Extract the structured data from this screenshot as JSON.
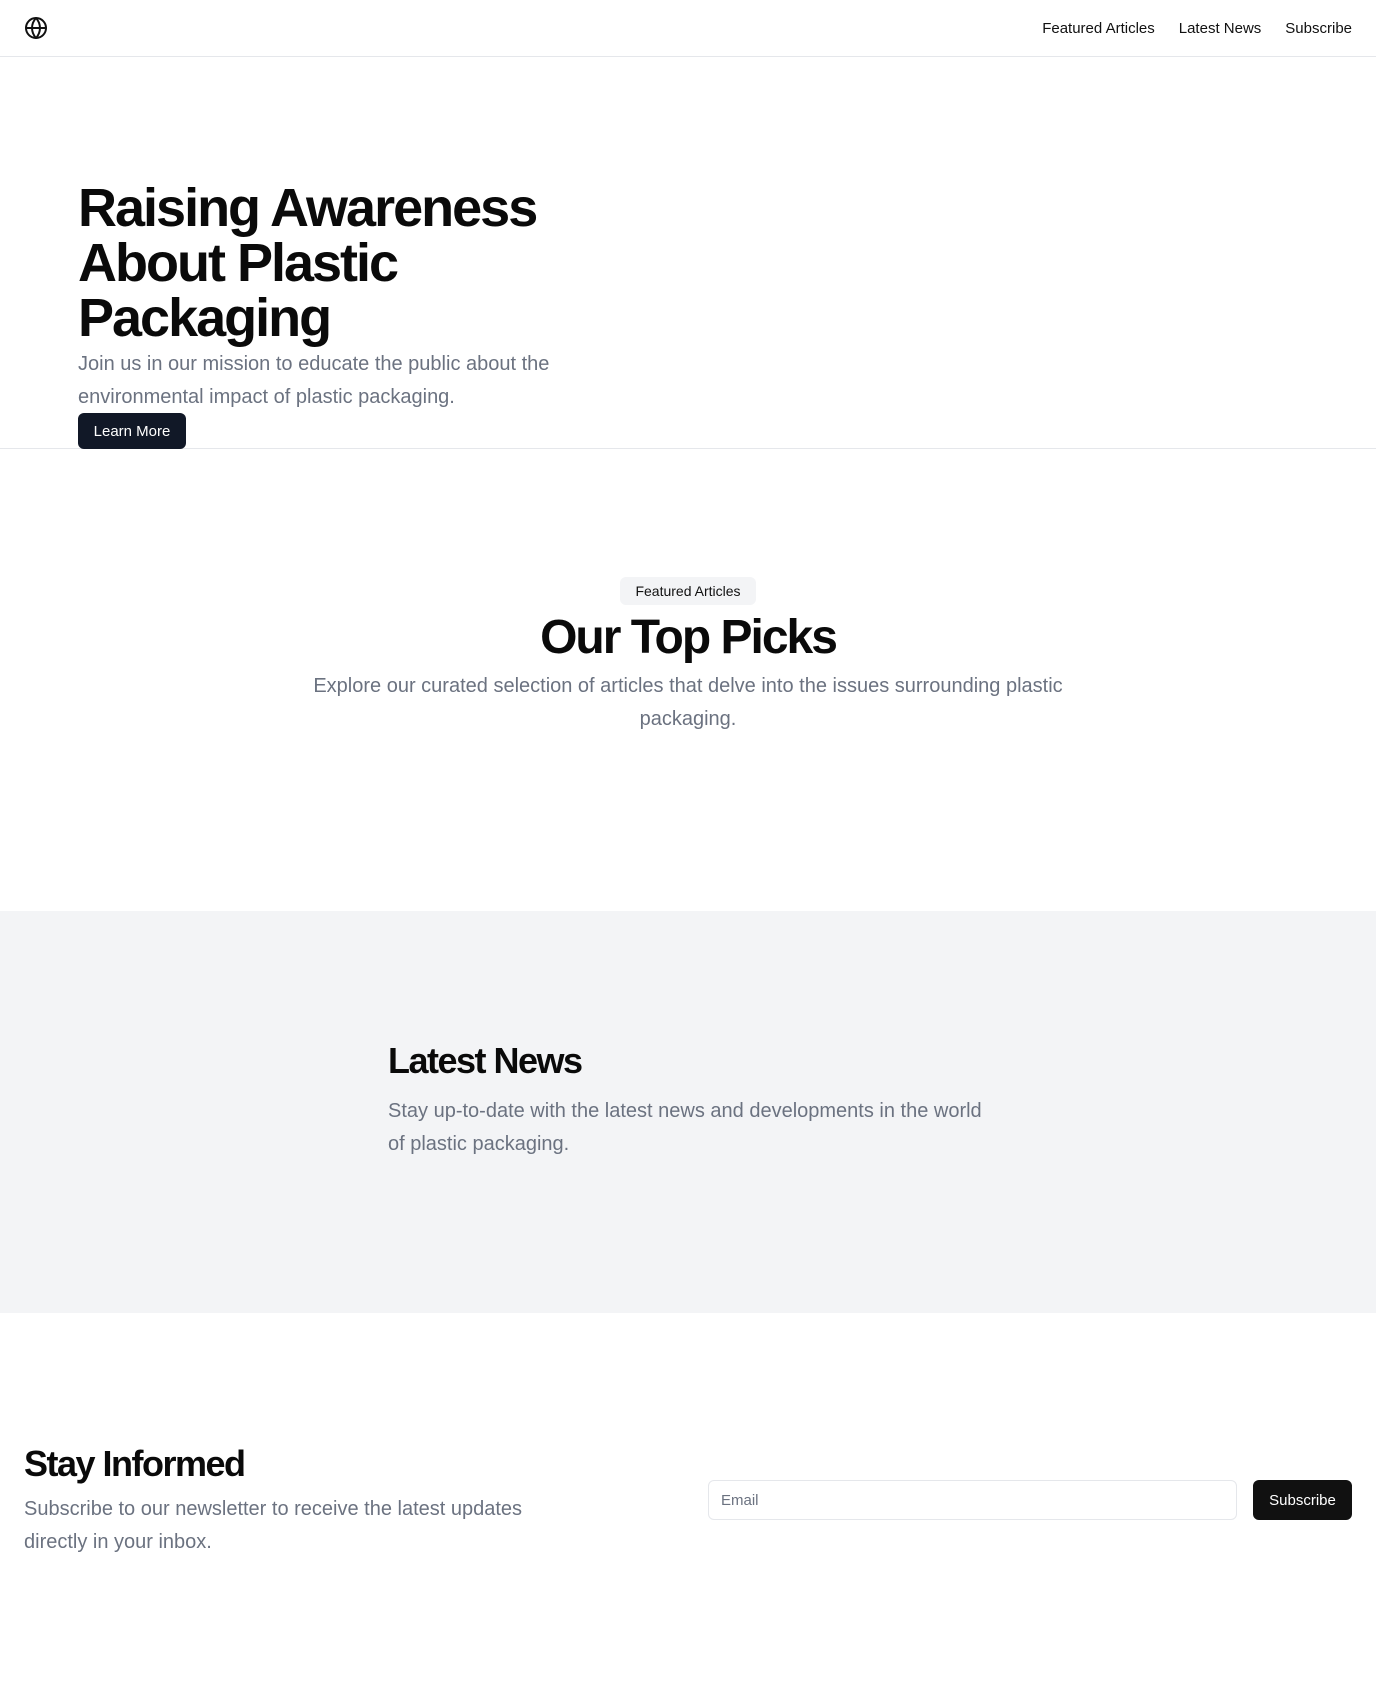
{
  "header": {
    "logo_icon": "globe-icon",
    "nav": [
      {
        "label": "Featured Articles"
      },
      {
        "label": "Latest News"
      },
      {
        "label": "Subscribe"
      }
    ]
  },
  "hero": {
    "title": "Raising Awareness About Plastic Packaging",
    "subtitle": "Join us in our mission to educate the public about the environmental impact of plastic packaging.",
    "cta_label": "Learn More"
  },
  "featured": {
    "badge": "Featured Articles",
    "title": "Our Top Picks",
    "subtitle": "Explore our curated selection of articles that delve into the issues surrounding plastic packaging."
  },
  "news": {
    "title": "Latest News",
    "subtitle": "Stay up-to-date with the latest news and developments in the world of plastic packaging."
  },
  "newsletter": {
    "title": "Stay Informed",
    "subtitle": "Subscribe to our newsletter to receive the latest updates directly in your inbox.",
    "email_placeholder": "Email",
    "email_value": "",
    "button_label": "Subscribe"
  },
  "colors": {
    "primary_button": "#111827",
    "muted_text": "#6b7280",
    "section_alt_bg": "#f3f4f6",
    "border": "#e5e7eb"
  }
}
